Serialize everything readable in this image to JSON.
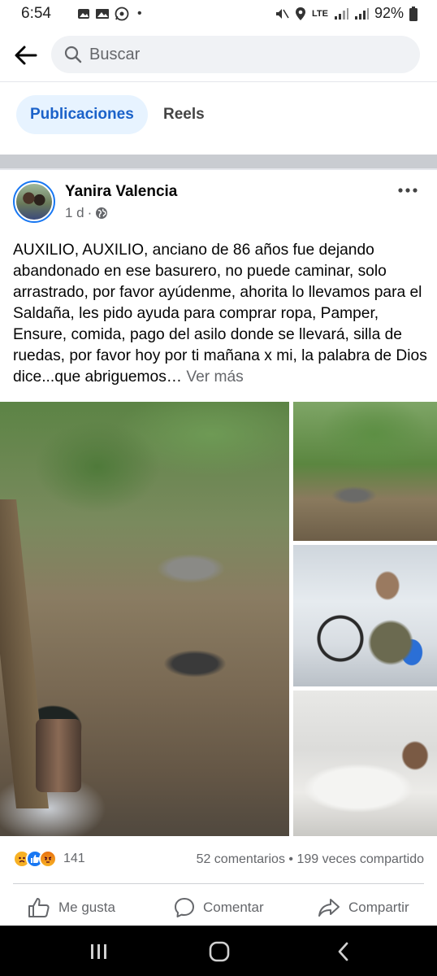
{
  "status_bar": {
    "time": "6:54",
    "network": "LTE",
    "battery": "92%"
  },
  "search": {
    "placeholder": "Buscar"
  },
  "tabs": [
    {
      "label": "Publicaciones",
      "active": true
    },
    {
      "label": "Reels",
      "active": false
    }
  ],
  "post": {
    "author": "Yanira Valencia",
    "time": "1 d",
    "dot": "·",
    "text": "AUXILIO, AUXILIO, anciano de 86 años fue dejando abandonado en ese basurero, no puede caminar, solo arrastrado, por favor ayúdenme, ahorita lo llevamos para el Saldaña, les pido ayuda para comprar ropa, Pamper, Ensure, comida, pago del asilo donde se llevará, silla de ruedas, por favor hoy por ti mañana x mi, la palabra de Dios dice...que abriguemos…",
    "see_more": "Ver más",
    "reaction_count": "141",
    "comments": "52 comentarios",
    "separator": "•",
    "shares": "199 veces compartido"
  },
  "actions": {
    "like": "Me gusta",
    "comment": "Comentar",
    "share": "Compartir"
  },
  "colors": {
    "accent": "#1877f2",
    "tab_active_bg": "#e7f3ff",
    "tab_active_text": "#1b62c9",
    "secondary_text": "#65676b"
  }
}
